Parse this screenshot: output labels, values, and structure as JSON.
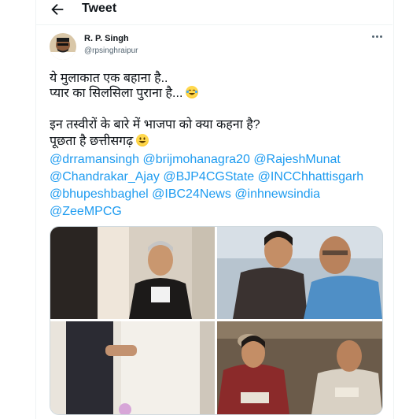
{
  "header": {
    "title": "Tweet"
  },
  "author": {
    "name": "R. P. Singh",
    "handle": "@rpsinghraipur"
  },
  "tweet": {
    "line1": "ये मुलाकात एक बहाना है..",
    "line2": "प्यार का सिलसिला पुराना है...",
    "line3": "इन तस्वीरों के बारे में भाजपा को क्या कहना है?",
    "line4": "पूछता है छत्तीसगढ़",
    "emoji1": "face-with-tears-of-joy",
    "emoji2": "grinning-face",
    "mentions": [
      "@drramansingh",
      "@brijmohanagra20",
      "@RajeshMunat",
      "@Chandrakar_Ajay",
      "@BJP4CGState",
      "@INCChhattisgarh",
      "@bhupeshbaghel",
      "@IBC24News",
      "@inhnewsindia",
      "@ZeeMPCG"
    ]
  },
  "colors": {
    "link": "#1d9bf0",
    "text": "#0f1419",
    "secondary": "#536471",
    "border": "#eff3f4"
  },
  "icons": {
    "back": "arrow-left-icon",
    "more": "more-horizontal-icon"
  }
}
